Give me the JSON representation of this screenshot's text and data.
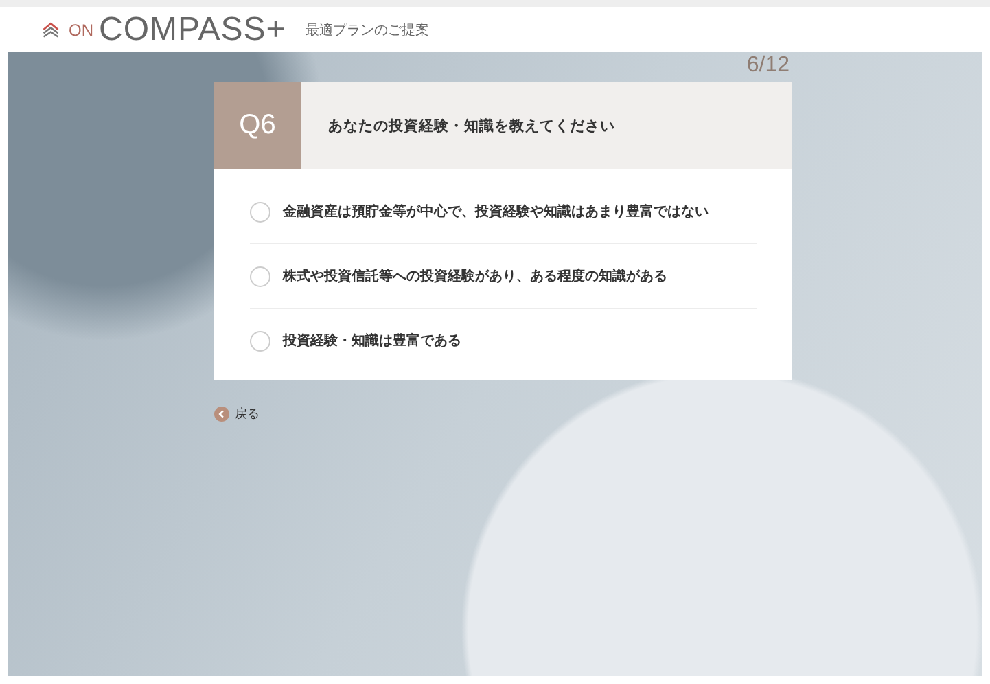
{
  "header": {
    "logo_prefix": "ON",
    "logo_name": "COMPASS+",
    "subtitle": "最適プランのご提案"
  },
  "progress": "6/12",
  "question": {
    "number": "Q6",
    "text": "あなたの投資経験・知識を教えてください",
    "options": [
      {
        "label": "金融資産は預貯金等が中心で、投資経験や知識はあまり豊富ではない",
        "selected": false
      },
      {
        "label": "株式や投資信託等への投資経験があり、ある程度の知識がある",
        "selected": false
      },
      {
        "label": "投資経験・知識は豊富である",
        "selected": false
      }
    ]
  },
  "back_link": "戻る"
}
